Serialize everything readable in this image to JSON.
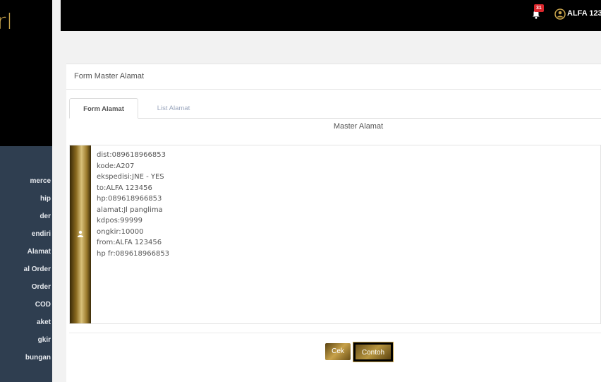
{
  "brand": {
    "logo_text": "rl"
  },
  "sidebar": {
    "items": [
      {
        "label": "merce"
      },
      {
        "label": "hip"
      },
      {
        "label": "der"
      },
      {
        "label": "endiri"
      },
      {
        "label": "Alamat"
      },
      {
        "label": "al Order"
      },
      {
        "label": "Order"
      },
      {
        "label": "COD"
      },
      {
        "label": "aket"
      },
      {
        "label": "gkir"
      },
      {
        "label": "bungan"
      }
    ]
  },
  "topbar": {
    "notification_count": "31",
    "user_name": "ALFA 123"
  },
  "panel": {
    "title": "Form Master Alamat",
    "tabs": [
      {
        "label": "Form Alamat",
        "active": true
      },
      {
        "label": "List Alamat",
        "active": false
      }
    ],
    "section_title": "Master Alamat",
    "textarea_value": "dist:089618966853\nkode:A207\nekspedisi:JNE - YES\nto:ALFA 123456\nhp:089618966853\nalamat:Jl panglima\nkdpos:99999\nongkir:10000\nfrom:ALFA 123456\nhp fr:089618966853",
    "buttons": {
      "cek": "Cek",
      "contoh": "Contoh"
    }
  },
  "colors": {
    "sidebar_bg": "#2f3e50",
    "topbar_bg": "#000000",
    "gold": "#c9a44c",
    "badge": "#d9262c"
  }
}
